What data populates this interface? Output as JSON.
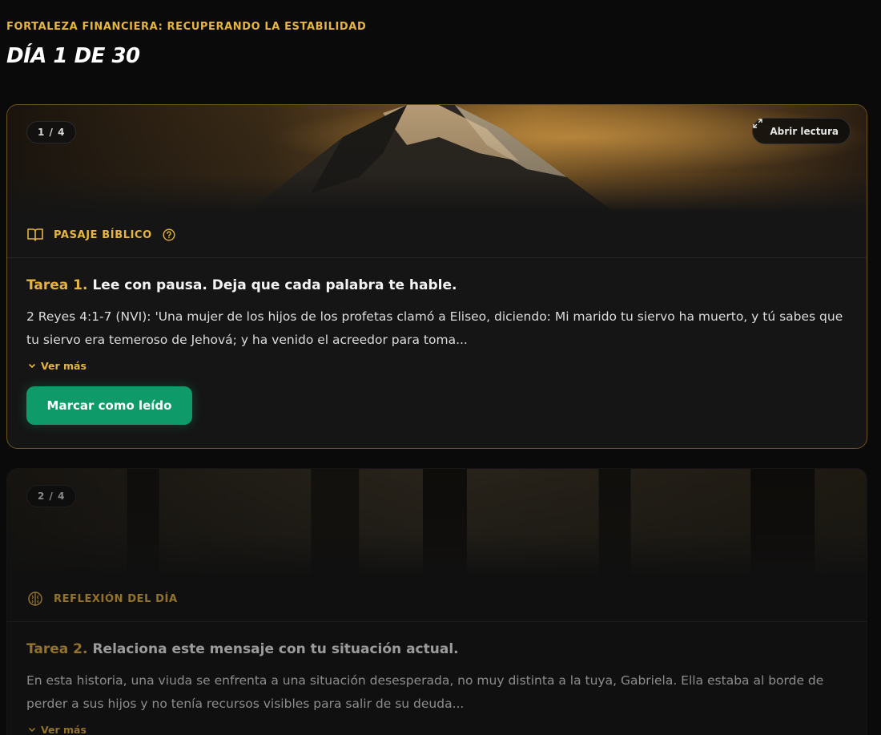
{
  "header": {
    "eyebrow": "FORTALEZA FINANCIERA: RECUPERANDO LA ESTABILIDAD",
    "day_title": "DÍA 1 DE 30"
  },
  "cards": [
    {
      "counter": "1 / 4",
      "open_label": "Abrir lectura",
      "section_label": "PASAJE BÍBLICO",
      "task_number": "Tarea 1.",
      "task_text": "Lee con pausa. Deja que cada palabra te hable.",
      "body": "2 Reyes 4:1-7 (NVI): 'Una mujer de los hijos de los profetas clamó a Eliseo, diciendo: Mi marido tu siervo ha muerto, y tú sabes que tu siervo era temeroso de Jehová; y ha venido el acreedor para toma...",
      "more_label": "Ver más",
      "action_label": "Marcar como leído"
    },
    {
      "counter": "2 / 4",
      "section_label": "REFLEXIÓN DEL DÍA",
      "task_number": "Tarea 2.",
      "task_text": "Relaciona este mensaje con tu situación actual.",
      "body": "En esta historia, una viuda se enfrenta a una situación desesperada, no muy distinta a la tuya, Gabriela. Ella estaba al borde de perder a sus hijos y no tenía recursos visibles para salir de su deuda...",
      "more_label": "Ver más"
    }
  ],
  "colors": {
    "accent": "#e7b43e",
    "success": "#0f9b69",
    "background": "#0a0a0a",
    "card": "#151515"
  },
  "icons": [
    "book-open-icon",
    "help-circle-icon",
    "expand-icon",
    "chevron-down-icon",
    "brain-icon"
  ]
}
